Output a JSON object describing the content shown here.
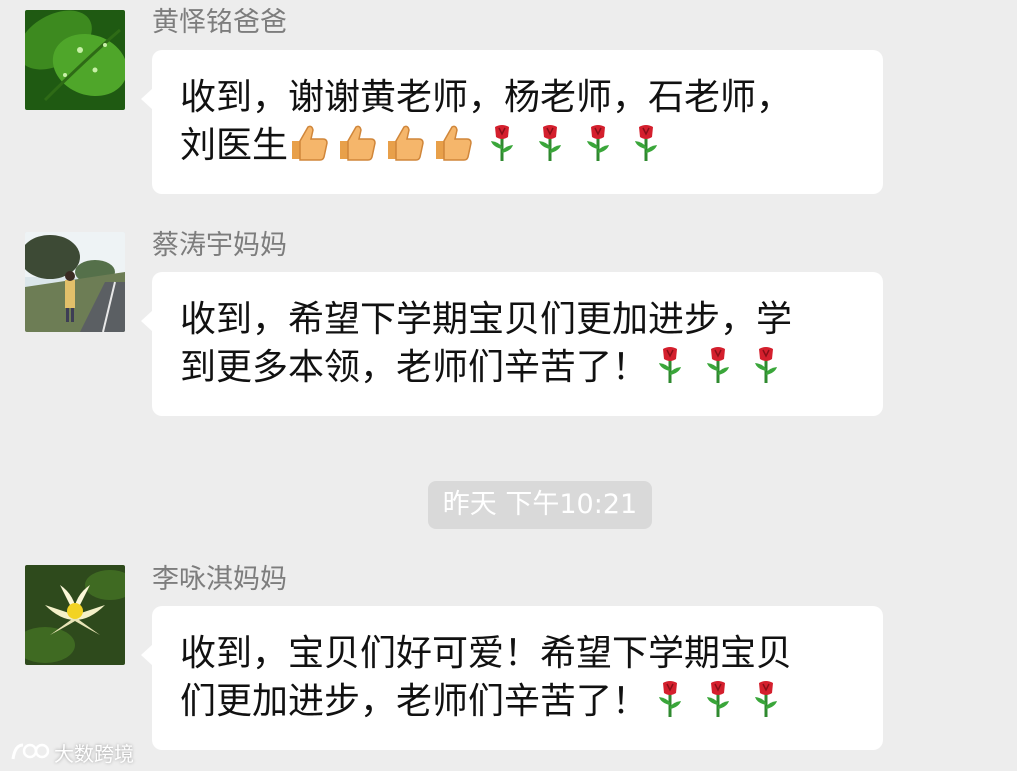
{
  "messages": [
    {
      "sender": "黄怿铭爸爸",
      "line1": "收到，谢谢黄老师，杨老师，石老师，",
      "line2": "刘医生",
      "emoji_icons": [
        "thumbs-up-icon",
        "thumbs-up-icon",
        "thumbs-up-icon",
        "thumbs-up-icon",
        "rose-icon",
        "rose-icon",
        "rose-icon",
        "rose-icon"
      ]
    },
    {
      "sender": "蔡涛宇妈妈",
      "line1": "收到，希望下学期宝贝们更加进步，学",
      "line2": "到更多本领，老师们辛苦了！",
      "emoji_icons": [
        "rose-icon",
        "rose-icon",
        "rose-icon"
      ]
    },
    {
      "sender": "李咏淇妈妈",
      "line1": "收到，宝贝们好可爱！希望下学期宝贝",
      "line2": "们更加进步，老师们辛苦了！",
      "emoji_icons": [
        "rose-icon",
        "rose-icon",
        "rose-icon"
      ]
    }
  ],
  "timestamp": "昨天 下午10:21",
  "watermark": {
    "text": "大数跨境",
    "logo_icon": "brand-logo-icon"
  },
  "colors": {
    "background": "#ededed",
    "bubble": "#ffffff",
    "sender_name": "#7d7d7d",
    "timestamp_badge": "#d9d9d9"
  }
}
